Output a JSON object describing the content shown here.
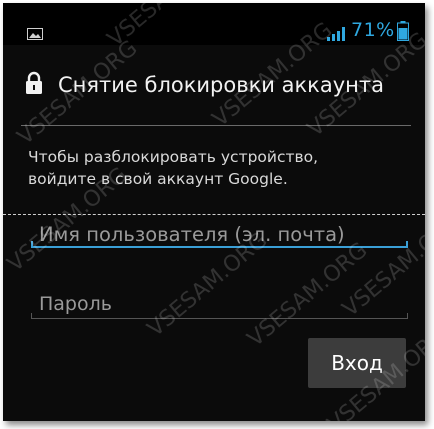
{
  "status_bar": {
    "battery_percent": "71%",
    "left_icon": "image-notification-icon",
    "signal_icon": "signal-bars-icon",
    "battery_icon": "battery-icon",
    "accent_color": "#2fa8e0"
  },
  "header": {
    "icon": "lock-icon",
    "title": "Снятие блокировки аккаунта"
  },
  "body": {
    "description_line1": "Чтобы разблокировать устройство,",
    "description_line2": "войдите в свой аккаунт Google."
  },
  "form": {
    "username_placeholder": "Имя пользователя (эл. почта)",
    "password_placeholder": "Пароль",
    "submit_label": "Вход"
  },
  "watermark": "VSESAM.ORG"
}
